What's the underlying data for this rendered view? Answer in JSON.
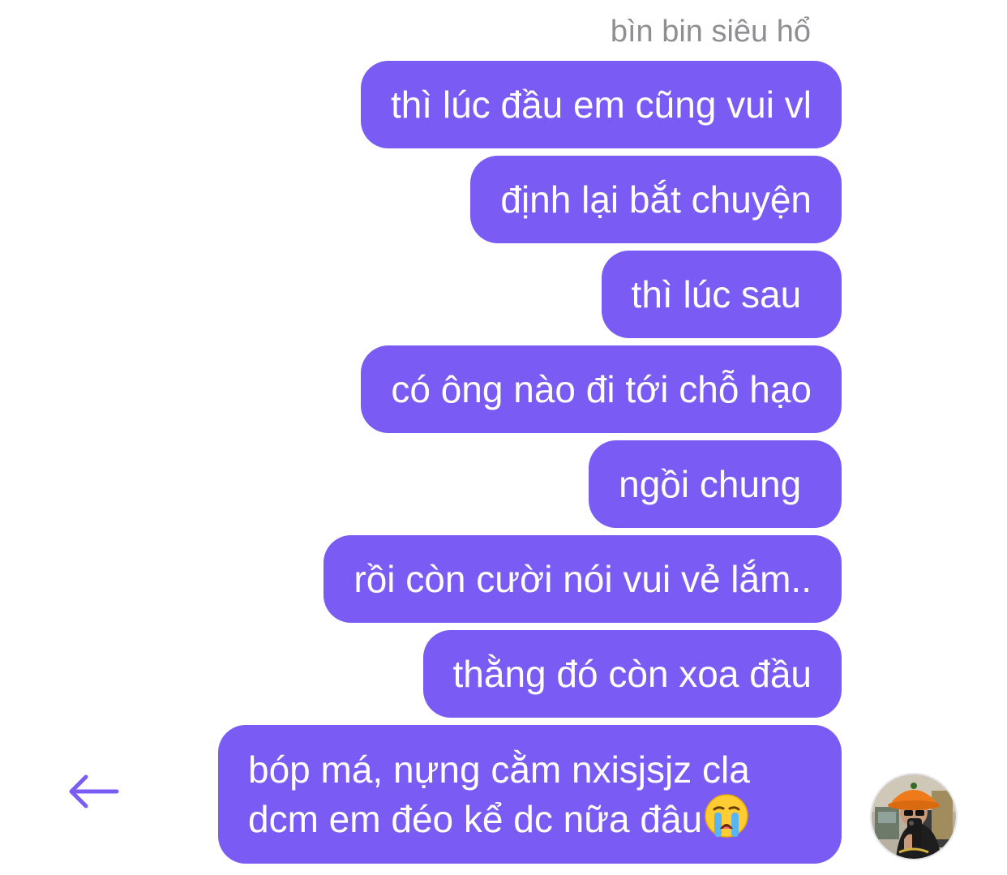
{
  "conversation": {
    "sender_name": "bìn bin siêu hổ"
  },
  "messages": [
    {
      "text": "thì lúc đầu em cũng vui vl"
    },
    {
      "text": "định lại bắt chuyện"
    },
    {
      "text": "thì lúc sau "
    },
    {
      "text": "có ông nào đi tới chỗ hạo"
    },
    {
      "text": "ngồi chung "
    },
    {
      "text": "rồi còn cười nói vui vẻ lắm.."
    },
    {
      "text": "thằng đó còn xoa đầu"
    },
    {
      "lines": [
        "bóp má, nựng cằm nxisjsjz cla",
        "dcm em đéo kể dc nữa đâu"
      ],
      "emoji": "loudly-crying-face-emoji"
    }
  ],
  "icons": {
    "back": "left-arrow-icon",
    "avatar": "user-avatar"
  },
  "colors": {
    "bubble": "#7a5cf5",
    "bubble_text": "#ffffff",
    "sender_name": "#8e8e93",
    "accent": "#7a5cf5"
  }
}
